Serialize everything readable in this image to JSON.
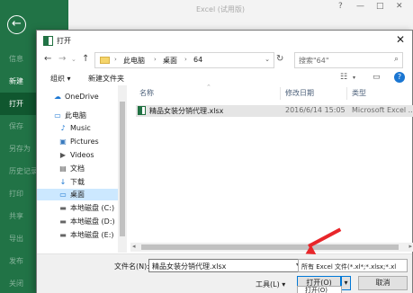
{
  "window": {
    "title": "Excel (试用版)",
    "controls": [
      "?",
      "—",
      "□",
      "✕"
    ]
  },
  "backstage": {
    "menu": [
      "信息",
      "新建",
      "打开",
      "保存",
      "另存为",
      "历史记录",
      "打印",
      "共享",
      "导出",
      "发布",
      "关闭"
    ]
  },
  "dialog": {
    "title": "打开",
    "path": [
      "此电脑",
      "桌面",
      "64"
    ],
    "search_placeholder": "搜索\"64\"",
    "organize": "组织 ▾",
    "new_folder": "新建文件夹",
    "tree": [
      {
        "icon": "☁",
        "label": "OneDrive",
        "selected": false
      },
      {
        "icon": "▭",
        "label": "此电脑",
        "selected": false
      },
      {
        "icon": "♪",
        "label": "Music",
        "selected": false
      },
      {
        "icon": "▣",
        "label": "Pictures",
        "selected": false
      },
      {
        "icon": "▶",
        "label": "Videos",
        "selected": false
      },
      {
        "icon": "▤",
        "label": "文档",
        "selected": false
      },
      {
        "icon": "↓",
        "label": "下载",
        "selected": false
      },
      {
        "icon": "▭",
        "label": "桌面",
        "selected": true
      },
      {
        "icon": "▬",
        "label": "本地磁盘 (C:)",
        "selected": false
      },
      {
        "icon": "▬",
        "label": "本地磁盘 (D:)",
        "selected": false
      },
      {
        "icon": "▬",
        "label": "本地磁盘 (E:)",
        "selected": false
      }
    ],
    "columns": [
      "名称",
      "修改日期",
      "类型"
    ],
    "files": [
      {
        "name": "精品女装分销代理.xlsx",
        "date": "2016/6/14 15:05",
        "type": "Microsoft Excel ..."
      }
    ],
    "filename_label": "文件名(N):",
    "filename_value": "精品女装分销代理.xlsx",
    "filetype_value": "所有 Excel 文件(*.xl*;*.xlsx;*.xl",
    "tools_label": "工具(L) ▾",
    "open_label": "打开(O)",
    "cancel_label": "取消",
    "open_menu_item": "打开(O)"
  },
  "colors": {
    "excel_green": "#217346",
    "selection": "#cce8ff",
    "annotation_arrow": "#e8262a"
  }
}
